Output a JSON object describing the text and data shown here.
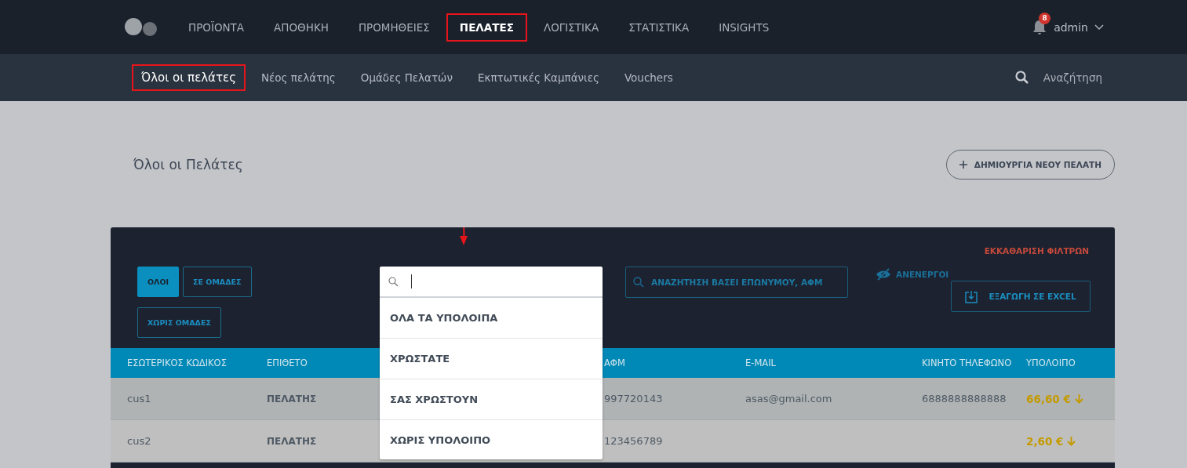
{
  "top_nav": {
    "items": [
      {
        "label": "ΠΡΟΪΟΝΤΑ",
        "selected": false,
        "highlighted": false
      },
      {
        "label": "ΑΠΟΘΗΚΗ",
        "selected": false,
        "highlighted": false
      },
      {
        "label": "ΠΡΟΜΗΘΕΙΕΣ",
        "selected": false,
        "highlighted": false
      },
      {
        "label": "ΠΕΛΑΤΕΣ",
        "selected": true,
        "highlighted": true
      },
      {
        "label": "ΛΟΓΙΣΤΙΚΑ",
        "selected": false,
        "highlighted": false
      },
      {
        "label": "ΣΤΑΤΙΣΤΙΚΑ",
        "selected": false,
        "highlighted": false
      },
      {
        "label": "INSIGHTS",
        "selected": false,
        "highlighted": false
      }
    ],
    "notification_count": "8",
    "user": "admin"
  },
  "sub_nav": {
    "items": [
      {
        "label": "Όλοι οι πελάτες",
        "selected": true,
        "highlighted": true
      },
      {
        "label": "Νέος πελάτης",
        "selected": false,
        "highlighted": false
      },
      {
        "label": "Ομάδες Πελατών",
        "selected": false,
        "highlighted": false
      },
      {
        "label": "Εκπτωτικές Καμπάνιες",
        "selected": false,
        "highlighted": false
      },
      {
        "label": "Vouchers",
        "selected": false,
        "highlighted": false
      }
    ],
    "search_label": "Αναζήτηση"
  },
  "page": {
    "title": "Όλοι οι Πελάτες",
    "create_button": "ΔΗΜΙΟΥΡΓΙΑ ΝΕΟΥ ΠΕΛΑΤΗ"
  },
  "filters": {
    "group_tabs": [
      {
        "label": "ΟΛΟΙ",
        "selected": true
      },
      {
        "label": "ΣΕ ΟΜΑΔΕΣ",
        "selected": false
      },
      {
        "label": "ΧΩΡΙΣ ΟΜΑΔΕΣ",
        "selected": false
      }
    ],
    "clear_filters": "ΕΚΚΑΘΑΡΙΣΗ ΦΙΛΤΡΩΝ",
    "search_placeholder": "ΑΝΑΖΗΤΗΣΗ ΒΑΣΕΙ ΕΠΩΝΥΜΟΥ, ΑΦΜ",
    "inactive_toggle": "ΑΝΕΝΕΡΓΟΙ",
    "export_button": "ΕΞΑΓΩΓΗ ΣΕ EXCEL",
    "balance_dropdown": {
      "expanded": true,
      "options": [
        "ΟΛΑ ΤΑ ΥΠΟΛΟΙΠΑ",
        "ΧΡΩΣΤΑΤΕ",
        "ΣΑΣ ΧΡΩΣΤΟΥΝ",
        "ΧΩΡΙΣ ΥΠΟΛΟΙΠΟ"
      ]
    }
  },
  "table": {
    "columns": [
      "ΕΣΩΤΕΡΙΚΟΣ ΚΩΔΙΚΟΣ",
      "ΕΠΙΘΕΤΟ",
      "ΑΦΜ",
      "E-MAIL",
      "ΚΙΝΗΤΟ ΤΗΛΕΦΩΝΟ",
      "ΥΠΟΛΟΙΠΟ"
    ],
    "rows": [
      {
        "code": "cus1",
        "surname": "ΠΕΛΑΤΗΣ",
        "afm": "997720143",
        "email": "asas@gmail.com",
        "phone": "6888888888888",
        "balance": "66,60 €"
      },
      {
        "code": "cus2",
        "surname": "ΠΕΛΑΤΗΣ",
        "afm": "123456789",
        "balance": "2,60 €"
      }
    ]
  }
}
